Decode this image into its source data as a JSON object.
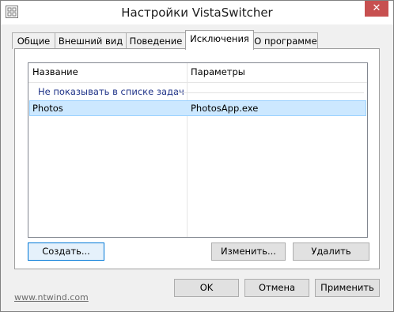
{
  "window": {
    "title": "Настройки VistaSwitcher",
    "close_glyph": "✕"
  },
  "tabs": [
    {
      "label": "Общие"
    },
    {
      "label": "Внешний вид"
    },
    {
      "label": "Поведение"
    },
    {
      "label": "Исключения",
      "active": true
    },
    {
      "label": "О программе"
    }
  ],
  "list": {
    "columns": [
      "Название",
      "Параметры"
    ],
    "group_label": "Не показывать в списке задач",
    "rows": [
      {
        "name": "Photos",
        "params": "PhotosApp.exe",
        "selected": true
      }
    ]
  },
  "list_buttons": {
    "create": "Создать...",
    "edit": "Изменить...",
    "delete": "Удалить"
  },
  "dialog_buttons": {
    "ok": "OK",
    "cancel": "Отмена",
    "apply": "Применить"
  },
  "footer": {
    "link": "www.ntwind.com"
  },
  "colors": {
    "selection_fill": "#cce8ff",
    "selection_border": "#99d1ff",
    "close_button": "#c75050",
    "group_header_text": "#1e3287"
  }
}
